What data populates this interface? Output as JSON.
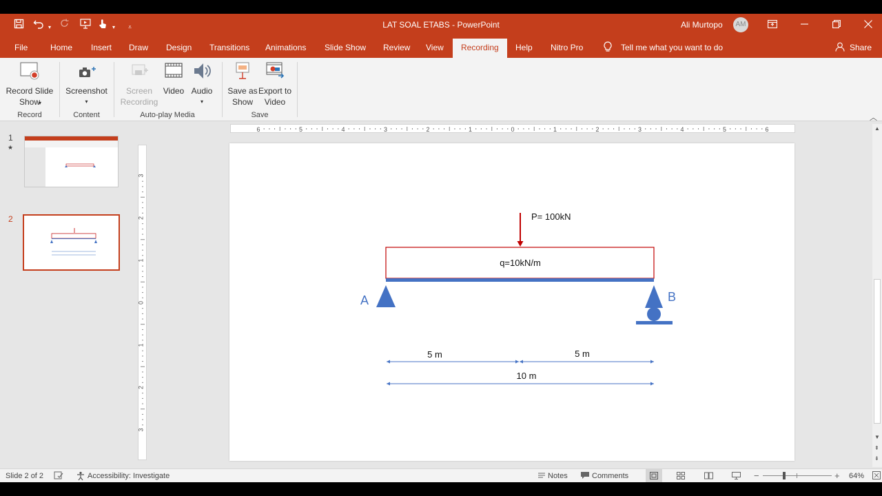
{
  "window": {
    "title": "LAT SOAL ETABS  -  PowerPoint",
    "user": "Ali Murtopo",
    "initials": "AM"
  },
  "tabs": [
    "File",
    "Home",
    "Insert",
    "Draw",
    "Design",
    "Transitions",
    "Animations",
    "Slide Show",
    "Review",
    "View",
    "Recording",
    "Help",
    "Nitro Pro"
  ],
  "active_tab": "Recording",
  "tell_me": "Tell me what you want to do",
  "share": "Share",
  "ribbon": {
    "record_slide_show": "Record Slide Show",
    "screenshot": "Screenshot",
    "screen_recording": "Screen Recording",
    "video": "Video",
    "audio": "Audio",
    "save_as_show": "Save as Show",
    "export_to_video": "Export to Video",
    "groups": {
      "record": "Record",
      "content": "Content",
      "autoplay": "Auto-play Media",
      "save": "Save"
    }
  },
  "thumbnails": [
    {
      "num": "1",
      "star": "★"
    },
    {
      "num": "2"
    }
  ],
  "slide": {
    "load_label": "P= 100kN",
    "udl_label": "q=10kN/m",
    "support_a": "A",
    "support_b": "B",
    "dim_left": "5 m",
    "dim_right": "5 m",
    "dim_total": "10 m"
  },
  "statusbar": {
    "slide_info": "Slide 2 of 2",
    "accessibility": "Accessibility: Investigate",
    "notes": "Notes",
    "comments": "Comments",
    "zoom": "64%"
  },
  "colors": {
    "accent": "#c43e1c",
    "support": "#4472c4",
    "load": "#c00000"
  },
  "ruler_h_labels": [
    "6",
    "5",
    "4",
    "3",
    "2",
    "1",
    "0",
    "1",
    "2",
    "3",
    "4",
    "5",
    "6"
  ],
  "ruler_v_labels": [
    "3",
    "2",
    "1",
    "0",
    "1",
    "2",
    "3"
  ]
}
